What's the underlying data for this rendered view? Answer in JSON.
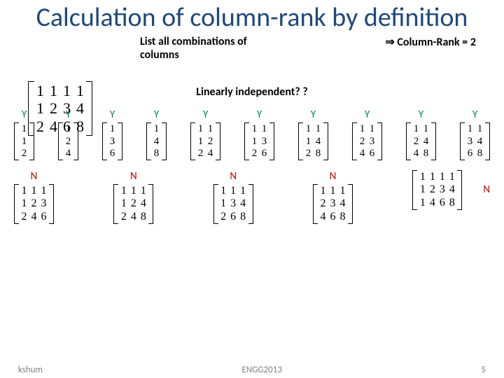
{
  "title": "Calculation of column-rank by definition",
  "subtitle_left": "List all combinations of columns",
  "subtitle_right_arrow": "⇒",
  "subtitle_right": "Column-Rank = 2",
  "main_matrix": [
    [
      1,
      1,
      1,
      1
    ],
    [
      1,
      2,
      3,
      4
    ],
    [
      2,
      4,
      6,
      8
    ]
  ],
  "linearly_q": "Linearly independent? ?",
  "row1": [
    {
      "label": "Y",
      "m": [
        [
          1
        ],
        [
          1
        ],
        [
          2
        ]
      ]
    },
    {
      "label": "Y",
      "m": [
        [
          1
        ],
        [
          2
        ],
        [
          4
        ]
      ]
    },
    {
      "label": "Y",
      "m": [
        [
          1
        ],
        [
          3
        ],
        [
          6
        ]
      ]
    },
    {
      "label": "Y",
      "m": [
        [
          1
        ],
        [
          4
        ],
        [
          8
        ]
      ]
    },
    {
      "label": "Y",
      "m": [
        [
          1,
          1
        ],
        [
          1,
          2
        ],
        [
          2,
          4
        ]
      ]
    },
    {
      "label": "Y",
      "m": [
        [
          1,
          1
        ],
        [
          1,
          3
        ],
        [
          2,
          6
        ]
      ]
    },
    {
      "label": "Y",
      "m": [
        [
          1,
          1
        ],
        [
          1,
          4
        ],
        [
          2,
          8
        ]
      ]
    },
    {
      "label": "Y",
      "m": [
        [
          1,
          1
        ],
        [
          2,
          3
        ],
        [
          4,
          6
        ]
      ]
    },
    {
      "label": "Y",
      "m": [
        [
          1,
          1
        ],
        [
          2,
          4
        ],
        [
          4,
          8
        ]
      ]
    },
    {
      "label": "Y",
      "m": [
        [
          1,
          1
        ],
        [
          3,
          4
        ],
        [
          6,
          8
        ]
      ]
    }
  ],
  "row2": [
    {
      "label": "N",
      "m": [
        [
          1,
          1,
          1
        ],
        [
          1,
          2,
          3
        ],
        [
          2,
          4,
          6
        ]
      ]
    },
    {
      "label": "N",
      "m": [
        [
          1,
          1,
          1
        ],
        [
          1,
          2,
          4
        ],
        [
          2,
          4,
          8
        ]
      ]
    },
    {
      "label": "N",
      "m": [
        [
          1,
          1,
          1
        ],
        [
          1,
          3,
          4
        ],
        [
          2,
          6,
          8
        ]
      ]
    },
    {
      "label": "N",
      "m": [
        [
          1,
          1,
          1
        ],
        [
          2,
          3,
          4
        ],
        [
          4,
          6,
          8
        ]
      ]
    },
    {
      "label": "N",
      "m": [
        [
          1,
          1,
          1,
          1
        ],
        [
          1,
          2,
          3,
          4
        ],
        [
          1,
          4,
          6,
          8
        ]
      ]
    }
  ],
  "footer_left": "kshum",
  "footer_center": "ENGG2013",
  "footer_right": "5"
}
